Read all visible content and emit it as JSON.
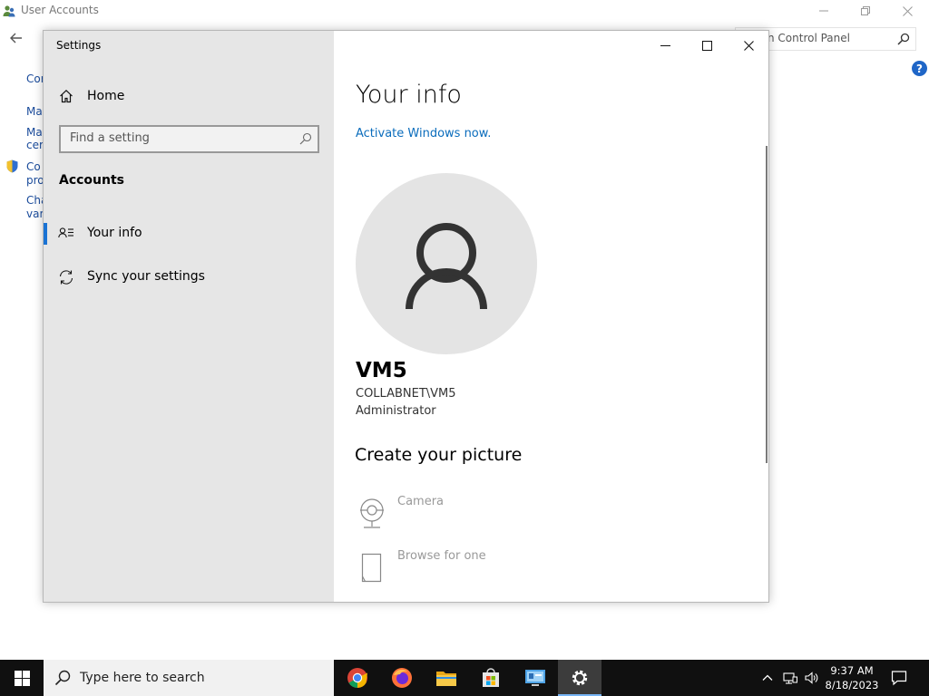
{
  "background_window": {
    "title": "User Accounts",
    "search_text": "n Control Panel",
    "help_label": "?",
    "left_items": [
      "Cor",
      "Ma",
      "Ma",
      "cert",
      "Co",
      "pro",
      "Cha",
      "vari"
    ]
  },
  "settings": {
    "window_title": "Settings",
    "home_label": "Home",
    "search_placeholder": "Find a setting",
    "section_title": "Accounts",
    "nav_items": [
      {
        "label": "Your info",
        "icon": "person-list-icon",
        "active": true
      },
      {
        "label": "Sync your settings",
        "icon": "sync-icon",
        "active": false
      }
    ],
    "page_title": "Your info",
    "activate_link": "Activate Windows now.",
    "user": {
      "name": "VM5",
      "domain": "COLLABNET\\VM5",
      "role": "Administrator"
    },
    "create_title": "Create your picture",
    "options": [
      {
        "label": "Camera",
        "icon": "camera-icon"
      },
      {
        "label": "Browse for one",
        "icon": "browse-icon"
      }
    ]
  },
  "taskbar": {
    "search_placeholder": "Type here to search",
    "apps": [
      "chrome",
      "firefox",
      "file-explorer",
      "store",
      "control-panel",
      "settings"
    ],
    "time": "9:37 AM",
    "date": "8/18/2023"
  },
  "colors": {
    "accent": "#1a73d4",
    "link": "#0a6cbc",
    "sidebar_bg": "#e6e6e6",
    "taskbar_bg": "#101010"
  }
}
